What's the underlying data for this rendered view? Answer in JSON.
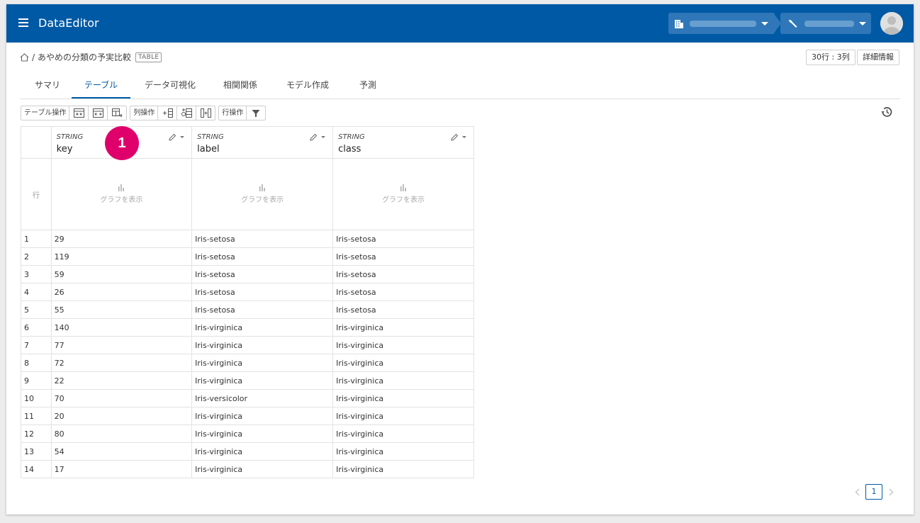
{
  "app": {
    "title": "DataEditor"
  },
  "breadcrumb": {
    "name": "あやめの分類の予実比較",
    "tag": "TABLE",
    "separator": "/"
  },
  "header_buttons": {
    "size": "30行 : 3列",
    "details": "詳細情報"
  },
  "tabs": [
    {
      "label": "サマリ"
    },
    {
      "label": "テーブル",
      "active": true
    },
    {
      "label": "データ可視化"
    },
    {
      "label": "相関関係"
    },
    {
      "label": "モデル作成"
    },
    {
      "label": "予測"
    }
  ],
  "toolbar": {
    "table_ops": "テーブル操作",
    "column_ops": "列操作",
    "row_ops": "行操作"
  },
  "columns": [
    {
      "type": "STRING",
      "name": "key"
    },
    {
      "type": "STRING",
      "name": "label"
    },
    {
      "type": "STRING",
      "name": "class"
    }
  ],
  "grid": {
    "row_header": "行",
    "graph_label": "グラフを表示"
  },
  "rows": [
    [
      "1",
      "29",
      "Iris-setosa",
      "Iris-setosa"
    ],
    [
      "2",
      "119",
      "Iris-setosa",
      "Iris-setosa"
    ],
    [
      "3",
      "59",
      "Iris-setosa",
      "Iris-setosa"
    ],
    [
      "4",
      "26",
      "Iris-setosa",
      "Iris-setosa"
    ],
    [
      "5",
      "55",
      "Iris-setosa",
      "Iris-setosa"
    ],
    [
      "6",
      "140",
      "Iris-virginica",
      "Iris-virginica"
    ],
    [
      "7",
      "77",
      "Iris-virginica",
      "Iris-virginica"
    ],
    [
      "8",
      "72",
      "Iris-virginica",
      "Iris-virginica"
    ],
    [
      "9",
      "22",
      "Iris-virginica",
      "Iris-virginica"
    ],
    [
      "10",
      "70",
      "Iris-versicolor",
      "Iris-virginica"
    ],
    [
      "11",
      "20",
      "Iris-virginica",
      "Iris-virginica"
    ],
    [
      "12",
      "80",
      "Iris-virginica",
      "Iris-virginica"
    ],
    [
      "13",
      "54",
      "Iris-virginica",
      "Iris-virginica"
    ],
    [
      "14",
      "17",
      "Iris-virginica",
      "Iris-virginica"
    ]
  ],
  "annotation": {
    "label": "1"
  },
  "pagination": {
    "current": "1"
  },
  "colors": {
    "primary": "#0059a5",
    "badge": "#e0006b"
  }
}
